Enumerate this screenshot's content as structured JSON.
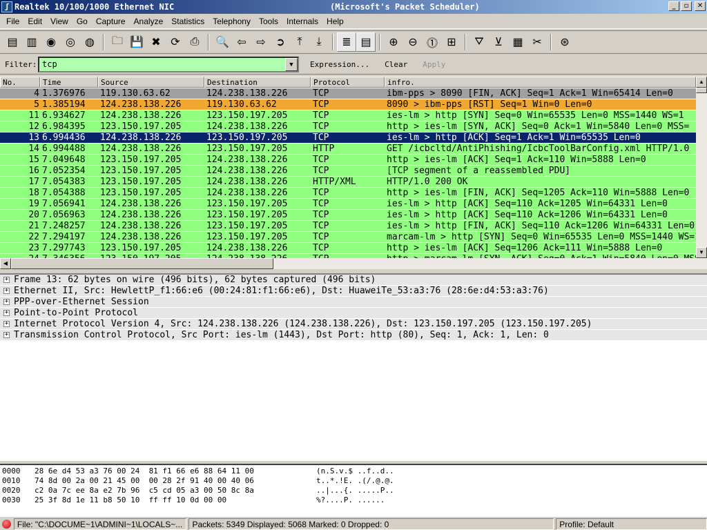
{
  "window": {
    "title": "Realtek 10/100/1000 Ethernet NIC",
    "title_suffix": "(Microsoft's Packet Scheduler)",
    "minimize": "_",
    "maximize": "▫",
    "close": "✕"
  },
  "menu": [
    "File",
    "Edit",
    "View",
    "Go",
    "Capture",
    "Analyze",
    "Statistics",
    "Telephony",
    "Tools",
    "Internals",
    "Help"
  ],
  "toolbar": [
    {
      "icon": "interfaces-icon",
      "glyph": "▤"
    },
    {
      "icon": "capture-options-icon",
      "glyph": "▥"
    },
    {
      "icon": "start-capture-icon",
      "glyph": "◉"
    },
    {
      "icon": "stop-capture-icon",
      "glyph": "◎"
    },
    {
      "icon": "restart-capture-icon",
      "glyph": "◍"
    },
    {
      "sep": true
    },
    {
      "icon": "open-file-icon",
      "glyph": "🗀"
    },
    {
      "icon": "save-file-icon",
      "glyph": "💾"
    },
    {
      "icon": "close-file-icon",
      "glyph": "✖"
    },
    {
      "icon": "reload-icon",
      "glyph": "⟳"
    },
    {
      "icon": "print-icon",
      "glyph": "⎙"
    },
    {
      "sep": true
    },
    {
      "icon": "find-packet-icon",
      "glyph": "🔍"
    },
    {
      "icon": "go-back-icon",
      "glyph": "⇦"
    },
    {
      "icon": "go-forward-icon",
      "glyph": "⇨"
    },
    {
      "icon": "go-to-packet-icon",
      "glyph": "➲"
    },
    {
      "icon": "go-first-icon",
      "glyph": "⤒"
    },
    {
      "icon": "go-last-icon",
      "glyph": "⤓"
    },
    {
      "sep": true
    },
    {
      "icon": "colorize-icon",
      "glyph": "≣",
      "pressed": true
    },
    {
      "icon": "auto-scroll-icon",
      "glyph": "▤",
      "pressed": true
    },
    {
      "sep": true
    },
    {
      "icon": "zoom-in-icon",
      "glyph": "⊕"
    },
    {
      "icon": "zoom-out-icon",
      "glyph": "⊖"
    },
    {
      "icon": "zoom-normal-icon",
      "glyph": "⓵"
    },
    {
      "icon": "resize-columns-icon",
      "glyph": "⊞"
    },
    {
      "sep": true
    },
    {
      "icon": "capture-filters-icon",
      "glyph": "⛛"
    },
    {
      "icon": "display-filters-icon",
      "glyph": "⊻"
    },
    {
      "icon": "coloring-rules-icon",
      "glyph": "▦"
    },
    {
      "icon": "preferences-icon",
      "glyph": "✂"
    },
    {
      "sep": true
    },
    {
      "icon": "help-icon",
      "glyph": "⊛"
    }
  ],
  "filter": {
    "label": "Filter:",
    "value": "tcp",
    "expression": "Expression...",
    "clear": "Clear",
    "apply": "Apply",
    "bg_color": "#afffaf"
  },
  "packet_list": {
    "columns": [
      "No.",
      "Time",
      "Source",
      "Destination",
      "Protocol",
      "infro."
    ],
    "colors": {
      "gray": "#a0a0a0",
      "orange": "#f0a830",
      "green": "#90ff80",
      "selected": "#0a246a"
    },
    "rows": [
      {
        "no": "4",
        "time": "1.376976",
        "src": "119.130.63.62",
        "dst": "124.238.138.226",
        "proto": "TCP",
        "info": "ibm-pps > 8090 [FIN, ACK] Seq=1 Ack=1 Win=65414 Len=0",
        "color": "gray"
      },
      {
        "no": "5",
        "time": "1.385194",
        "src": "124.238.138.226",
        "dst": "119.130.63.62",
        "proto": "TCP",
        "info": "8090 > ibm-pps [RST] Seq=1 Win=0 Len=0",
        "color": "orange"
      },
      {
        "no": "11",
        "time": "6.934627",
        "src": "124.238.138.226",
        "dst": "123.150.197.205",
        "proto": "TCP",
        "info": "ies-lm > http [SYN] Seq=0 Win=65535 Len=0 MSS=1440 WS=1",
        "color": "green"
      },
      {
        "no": "12",
        "time": "6.984395",
        "src": "123.150.197.205",
        "dst": "124.238.138.226",
        "proto": "TCP",
        "info": "http > ies-lm [SYN, ACK] Seq=0 Ack=1 Win=5840 Len=0 MSS=",
        "color": "green"
      },
      {
        "no": "13",
        "time": "6.994436",
        "src": "124.238.138.226",
        "dst": "123.150.197.205",
        "proto": "TCP",
        "info": "ies-lm > http [ACK] Seq=1 Ack=1 Win=65535 Len=0",
        "color": "selected"
      },
      {
        "no": "14",
        "time": "6.994488",
        "src": "124.238.138.226",
        "dst": "123.150.197.205",
        "proto": "HTTP",
        "info": "GET /icbcltd/AntiPhishing/IcbcToolBarConfig.xml HTTP/1.0",
        "color": "green"
      },
      {
        "no": "15",
        "time": "7.049648",
        "src": "123.150.197.205",
        "dst": "124.238.138.226",
        "proto": "TCP",
        "info": "http > ies-lm [ACK] Seq=1 Ack=110 Win=5888 Len=0",
        "color": "green"
      },
      {
        "no": "16",
        "time": "7.052354",
        "src": "123.150.197.205",
        "dst": "124.238.138.226",
        "proto": "TCP",
        "info": "[TCP segment of a reassembled PDU]",
        "color": "green"
      },
      {
        "no": "17",
        "time": "7.054383",
        "src": "123.150.197.205",
        "dst": "124.238.138.226",
        "proto": "HTTP/XML",
        "info": "HTTP/1.0 200 OK",
        "color": "green"
      },
      {
        "no": "18",
        "time": "7.054388",
        "src": "123.150.197.205",
        "dst": "124.238.138.226",
        "proto": "TCP",
        "info": "http > ies-lm [FIN, ACK] Seq=1205 Ack=110 Win=5888 Len=0",
        "color": "green"
      },
      {
        "no": "19",
        "time": "7.056941",
        "src": "124.238.138.226",
        "dst": "123.150.197.205",
        "proto": "TCP",
        "info": "ies-lm > http [ACK] Seq=110 Ack=1205 Win=64331 Len=0",
        "color": "green"
      },
      {
        "no": "20",
        "time": "7.056963",
        "src": "124.238.138.226",
        "dst": "123.150.197.205",
        "proto": "TCP",
        "info": "ies-lm > http [ACK] Seq=110 Ack=1206 Win=64331 Len=0",
        "color": "green"
      },
      {
        "no": "21",
        "time": "7.248257",
        "src": "124.238.138.226",
        "dst": "123.150.197.205",
        "proto": "TCP",
        "info": "ies-lm > http [FIN, ACK] Seq=110 Ack=1206 Win=64331 Len=0",
        "color": "green"
      },
      {
        "no": "22",
        "time": "7.294197",
        "src": "124.238.138.226",
        "dst": "123.150.197.205",
        "proto": "TCP",
        "info": "marcam-lm > http [SYN] Seq=0 Win=65535 Len=0 MSS=1440 WS=1",
        "color": "green"
      },
      {
        "no": "23",
        "time": "7.297743",
        "src": "123.150.197.205",
        "dst": "124.238.138.226",
        "proto": "TCP",
        "info": "http > ies-lm [ACK] Seq=1206 Ack=111 Win=5888 Len=0",
        "color": "green"
      },
      {
        "no": "24",
        "time": "7.346356",
        "src": "123.150.197.205",
        "dst": "124.238.138.226",
        "proto": "TCP",
        "info": "http > marcam-lm [SYN, ACK] Seq=0 Ack=1 Win=5840 Len=0 MSS=",
        "color": "green"
      }
    ]
  },
  "details": [
    "Frame 13: 62 bytes on wire (496 bits), 62 bytes captured (496 bits)",
    "Ethernet II, Src: HewlettP_f1:66:e6 (00:24:81:f1:66:e6), Dst: HuaweiTe_53:a3:76 (28:6e:d4:53:a3:76)",
    "PPP-over-Ethernet Session",
    "Point-to-Point Protocol",
    "Internet Protocol Version 4, Src: 124.238.138.226 (124.238.138.226), Dst: 123.150.197.205 (123.150.197.205)",
    "Transmission Control Protocol, Src Port: ies-lm (1443), Dst Port: http (80), Seq: 1, Ack: 1, Len: 0"
  ],
  "hex": [
    {
      "offset": "0000",
      "bytes": "28 6e d4 53 a3 76 00 24  81 f1 66 e6 88 64 11 00",
      "ascii": "(n.S.v.$ ..f..d.."
    },
    {
      "offset": "0010",
      "bytes": "74 8d 00 2a 00 21 45 00  00 28 2f 91 40 00 40 06",
      "ascii": "t..*.!E. .(/.@.@."
    },
    {
      "offset": "0020",
      "bytes": "c2 0a 7c ee 8a e2 7b 96  c5 cd 05 a3 00 50 8c 8a",
      "ascii": "..|...{. .....P.."
    },
    {
      "offset": "0030",
      "bytes": "25 3f 8d 1e 11 b8 50 10  ff ff 10 0d 00 00",
      "ascii": "%?....P. ......"
    }
  ],
  "status": {
    "file": "File: \"C:\\DOCUME~1\\ADMINI~1\\LOCALS~...",
    "packets": "Packets: 5349 Displayed: 5068 Marked: 0 Dropped: 0",
    "profile": "Profile: Default"
  }
}
